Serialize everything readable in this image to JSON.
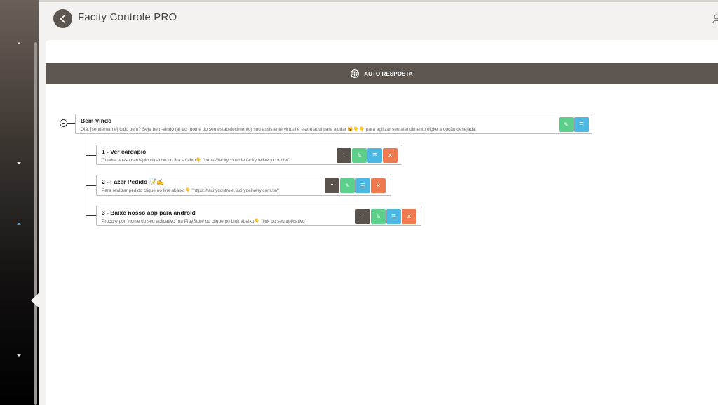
{
  "header": {
    "back_icon": "chevron-left-icon",
    "title": "Facity Controle PRO",
    "user_icon": "user-icon"
  },
  "section_bar": {
    "icon": "globe-icon",
    "label": "AUTO RESPOSTA"
  },
  "tree": {
    "root": {
      "title": "Bem Vindo",
      "description": "Olá, [sendername] tudo bem? Seja bem-vindo (a) ao {nome do seu estabelecimento} sou assistente virtual e estou aqui para ajudar 😺👇👇 para agilizar seu atendimento digite a opção desejada:",
      "actions": [
        "edit-icon",
        "list-icon"
      ]
    },
    "children": [
      {
        "title": "1 - Ver cardápio",
        "description": "Confira nosso cardápio clicando no link abaixo👇 \"https://facitycontrole.facitydelivery.com.br/\"",
        "actions": [
          "chevron-up-icon",
          "edit-icon",
          "list-icon",
          "close-icon"
        ]
      },
      {
        "title": "2 - Fazer Pedido 📝✍",
        "description": "Para realizar pedido clique no link abaixo👇 \"https://facitycontrole.facitydelivery.com.br/\"",
        "actions": [
          "chevron-up-icon",
          "edit-icon",
          "list-icon",
          "close-icon"
        ]
      },
      {
        "title": "3 - Baixe nosso app para android",
        "description": "Procure por \"nome do seu aplicativo\" na PlayStore ou clique no Link abaixo👇 \"link do seu aplicativo\"",
        "actions": [
          "chevron-up-icon",
          "edit-icon",
          "list-icon",
          "close-icon"
        ]
      }
    ]
  },
  "colors": {
    "bar": "#5e5751",
    "move_button": "#5a534d",
    "edit_button": "#5ccf8a",
    "list_button": "#4bb8e3",
    "delete_button": "#ef7a4f"
  }
}
